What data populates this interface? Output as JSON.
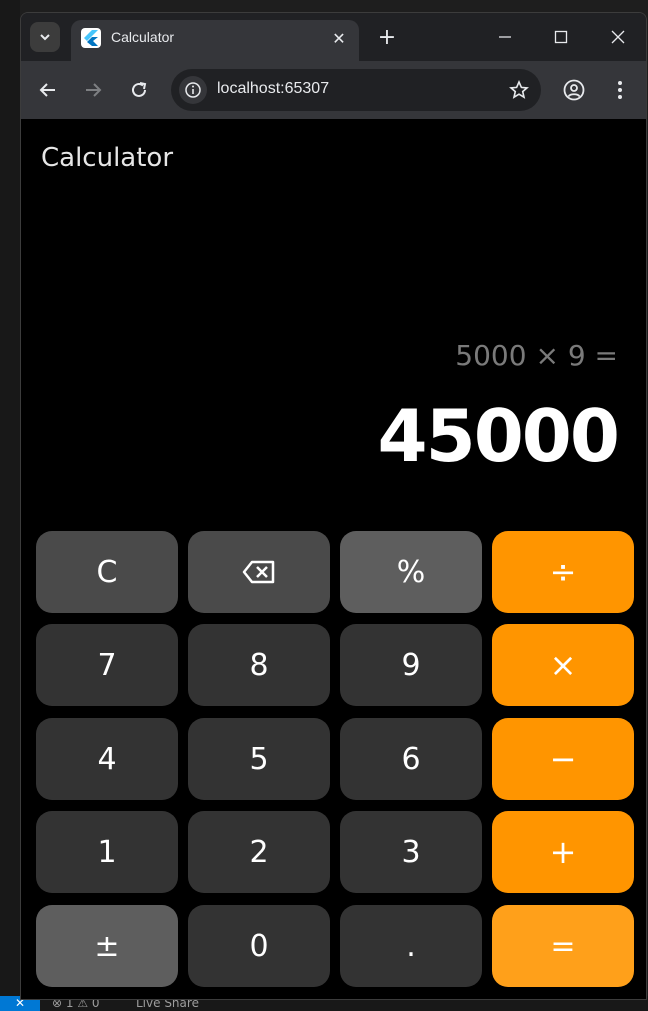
{
  "browser": {
    "tab_title": "Calculator",
    "url": "localhost:65307",
    "icons": [
      "tab-search-icon",
      "flutter-icon",
      "close-icon",
      "plus-icon",
      "minimize-icon",
      "maximize-icon",
      "window-close-icon",
      "back-icon",
      "forward-icon",
      "reload-icon",
      "info-icon",
      "star-icon",
      "profile-icon",
      "menu-icon"
    ]
  },
  "app": {
    "title": "Calculator",
    "expression": "5000 × 9 =",
    "result": "45000"
  },
  "keys": [
    {
      "label": "C"
    },
    {
      "label": "⌫"
    },
    {
      "label": "%"
    },
    {
      "label": "÷"
    },
    {
      "label": "7"
    },
    {
      "label": "8"
    },
    {
      "label": "9"
    },
    {
      "label": "×"
    },
    {
      "label": "4"
    },
    {
      "label": "5"
    },
    {
      "label": "6"
    },
    {
      "label": "−"
    },
    {
      "label": "1"
    },
    {
      "label": "2"
    },
    {
      "label": "3"
    },
    {
      "label": "+"
    },
    {
      "label": "±"
    },
    {
      "label": "0"
    },
    {
      "label": "."
    },
    {
      "label": "="
    }
  ],
  "ide_status": {
    "remote": "✕",
    "problems": "⊗ 1 ⚠ 0",
    "liveshare": "Live Share"
  },
  "colors": {
    "operator": "#ff9500",
    "number_key": "#333333",
    "function_key": "#5e5e5e",
    "background": "#000000"
  }
}
